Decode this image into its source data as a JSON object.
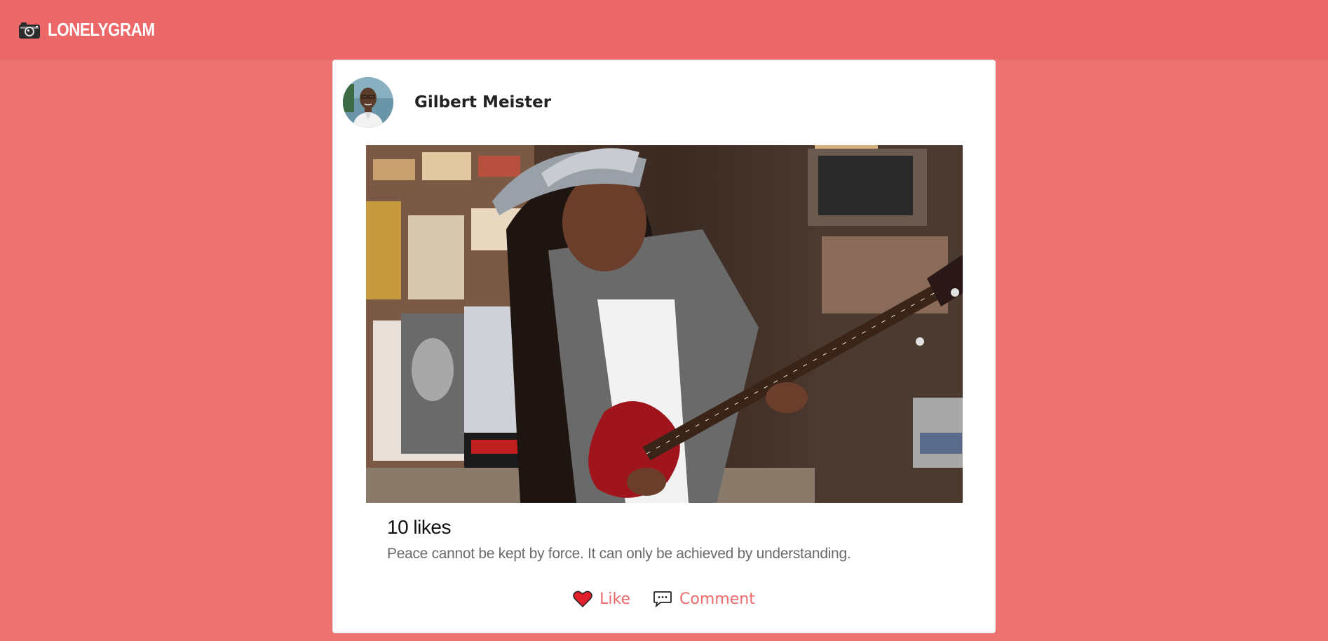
{
  "app": {
    "brand": "LONELYGRAM",
    "brand_icon": "camera-icon",
    "header_color": "#ec6868",
    "background_color": "#ed7170"
  },
  "post": {
    "author": "Gilbert Meister",
    "likes_text": "10 likes",
    "caption": "Peace cannot be kept by force. It can only be achieved by understanding.",
    "actions": {
      "like_label": "Like",
      "like_icon": "heart-icon",
      "comment_label": "Comment",
      "comment_icon": "comment-bubble-icon",
      "accent_color": "#ed6b6b"
    }
  }
}
